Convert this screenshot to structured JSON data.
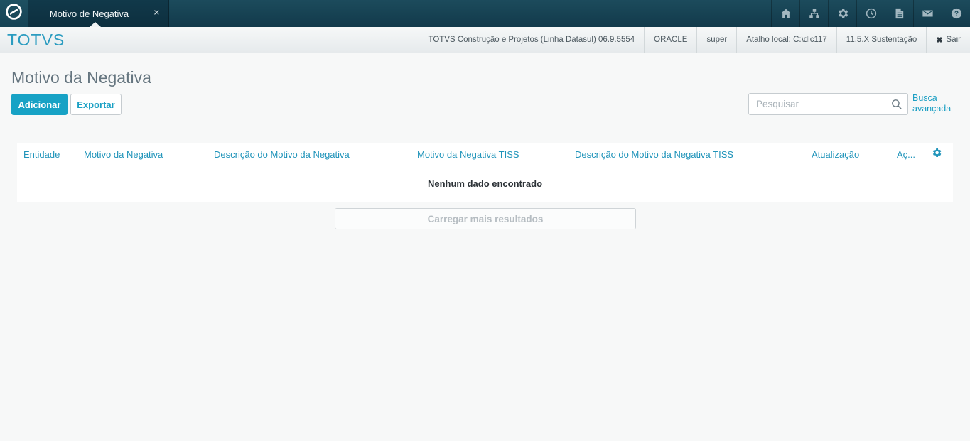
{
  "topbar": {
    "tab_title": "Motivo de Negativa",
    "tab_close_icon": "✕",
    "logo_icon": "totvs-logo",
    "nav_icons": [
      "home",
      "org-chart",
      "settings",
      "clock",
      "document",
      "mail",
      "help"
    ]
  },
  "header": {
    "brand": "TOTVS",
    "environment": "TOTVS Construção e Projetos (Linha Datasul) 06.9.5554",
    "database": "ORACLE",
    "user": "super",
    "local_shortcut": "Atalho local: C:\\dlc117",
    "version": "11.5.X Sustentação",
    "logout_icon": "✖",
    "logout_label": "Sair"
  },
  "page": {
    "title": "Motivo da Negativa",
    "add_button": "Adicionar",
    "export_button": "Exportar",
    "search_placeholder": "Pesquisar",
    "advanced_search_label": "Busca avançada"
  },
  "table": {
    "columns": [
      "Entidade",
      "Motivo da Negativa",
      "Descrição do Motivo da Negativa",
      "Motivo da Negativa TISS",
      "Descrição do Motivo da Negativa TISS",
      "Atualização",
      "Aç..."
    ],
    "rows": [],
    "empty_message": "Nenhum dado encontrado",
    "load_more_label": "Carregar mais resultados"
  },
  "colors": {
    "accent": "#1aa0c4",
    "topbar_bg": "#153d4e",
    "tab_bg": "#0e3141",
    "header_band_bg": "#eef1f2",
    "title_text": "#65757f",
    "column_header_text": "#2094ba"
  }
}
